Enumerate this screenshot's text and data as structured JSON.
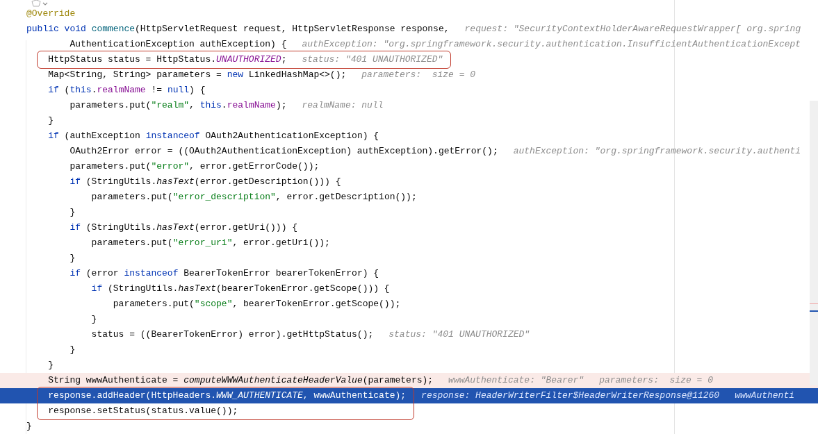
{
  "editor": {
    "lines": [
      {
        "executed": false,
        "current": false,
        "boxed": false,
        "tokens": [
          {
            "kind": "annotation",
            "text": "@Override"
          }
        ]
      },
      {
        "executed": false,
        "current": false,
        "boxed": false,
        "tokens": [
          {
            "kind": "keyword",
            "text": "public"
          },
          {
            "kind": "keyword",
            "text": " void"
          },
          {
            "kind": "method_decl",
            "text": " commence"
          },
          {
            "kind": "plain",
            "text": "(HttpServletRequest request, HttpServletResponse response,"
          }
        ],
        "hints": [
          "request: \"SecurityContextHolderAwareRequestWrapper[ org.spring"
        ]
      },
      {
        "executed": false,
        "current": false,
        "boxed": false,
        "tokens": [
          {
            "kind": "plain",
            "text": "        AuthenticationException authException) {"
          }
        ],
        "hints": [
          "authException: \"org.springframework.security.authentication.InsufficientAuthenticationExcept"
        ]
      },
      {
        "executed": false,
        "current": false,
        "boxed": true,
        "tokens": [
          {
            "kind": "plain",
            "text": "    HttpStatus status = HttpStatus."
          },
          {
            "kind": "constant",
            "text": "UNAUTHORIZED"
          },
          {
            "kind": "plain",
            "text": ";"
          }
        ],
        "hints": [
          "status: \"401 UNAUTHORIZED\""
        ]
      },
      {
        "executed": false,
        "current": false,
        "boxed": false,
        "tokens": [
          {
            "kind": "plain",
            "text": "    Map<String, String> parameters = "
          },
          {
            "kind": "keyword",
            "text": "new"
          },
          {
            "kind": "plain",
            "text": " LinkedHashMap<>();"
          }
        ],
        "hints": [
          "parameters:  size = 0"
        ]
      },
      {
        "executed": false,
        "current": false,
        "boxed": false,
        "tokens": [
          {
            "kind": "keyword",
            "text": "    if"
          },
          {
            "kind": "plain",
            "text": " ("
          },
          {
            "kind": "keyword",
            "text": "this"
          },
          {
            "kind": "plain",
            "text": "."
          },
          {
            "kind": "field",
            "text": "realmName"
          },
          {
            "kind": "plain",
            "text": " != "
          },
          {
            "kind": "keyword",
            "text": "null"
          },
          {
            "kind": "plain",
            "text": ") {"
          }
        ]
      },
      {
        "executed": false,
        "current": false,
        "boxed": false,
        "tokens": [
          {
            "kind": "plain",
            "text": "        parameters.put("
          },
          {
            "kind": "string",
            "text": "\"realm\""
          },
          {
            "kind": "plain",
            "text": ", "
          },
          {
            "kind": "keyword",
            "text": "this"
          },
          {
            "kind": "plain",
            "text": "."
          },
          {
            "kind": "field",
            "text": "realmName"
          },
          {
            "kind": "plain",
            "text": ");"
          }
        ],
        "hints": [
          "realmName: null"
        ]
      },
      {
        "executed": false,
        "current": false,
        "boxed": false,
        "tokens": [
          {
            "kind": "plain",
            "text": "    }"
          }
        ]
      },
      {
        "executed": false,
        "current": false,
        "boxed": false,
        "tokens": [
          {
            "kind": "keyword",
            "text": "    if"
          },
          {
            "kind": "plain",
            "text": " (authException "
          },
          {
            "kind": "keyword",
            "text": "instanceof"
          },
          {
            "kind": "plain",
            "text": " OAuth2AuthenticationException) {"
          }
        ]
      },
      {
        "executed": false,
        "current": false,
        "boxed": false,
        "tokens": [
          {
            "kind": "plain",
            "text": "        OAuth2Error error = ((OAuth2AuthenticationException) authException).getError();"
          }
        ],
        "hints": [
          "authException: \"org.springframework.security.authenti"
        ]
      },
      {
        "executed": false,
        "current": false,
        "boxed": false,
        "tokens": [
          {
            "kind": "plain",
            "text": "        parameters.put("
          },
          {
            "kind": "string",
            "text": "\"error\""
          },
          {
            "kind": "plain",
            "text": ", error.getErrorCode());"
          }
        ]
      },
      {
        "executed": false,
        "current": false,
        "boxed": false,
        "tokens": [
          {
            "kind": "keyword",
            "text": "        if"
          },
          {
            "kind": "plain",
            "text": " (StringUtils."
          },
          {
            "kind": "static_call",
            "text": "hasText"
          },
          {
            "kind": "plain",
            "text": "(error.getDescription())) {"
          }
        ]
      },
      {
        "executed": false,
        "current": false,
        "boxed": false,
        "tokens": [
          {
            "kind": "plain",
            "text": "            parameters.put("
          },
          {
            "kind": "string",
            "text": "\"error_description\""
          },
          {
            "kind": "plain",
            "text": ", error.getDescription());"
          }
        ]
      },
      {
        "executed": false,
        "current": false,
        "boxed": false,
        "tokens": [
          {
            "kind": "plain",
            "text": "        }"
          }
        ]
      },
      {
        "executed": false,
        "current": false,
        "boxed": false,
        "tokens": [
          {
            "kind": "keyword",
            "text": "        if"
          },
          {
            "kind": "plain",
            "text": " (StringUtils."
          },
          {
            "kind": "static_call",
            "text": "hasText"
          },
          {
            "kind": "plain",
            "text": "(error.getUri())) {"
          }
        ]
      },
      {
        "executed": false,
        "current": false,
        "boxed": false,
        "tokens": [
          {
            "kind": "plain",
            "text": "            parameters.put("
          },
          {
            "kind": "string",
            "text": "\"error_uri\""
          },
          {
            "kind": "plain",
            "text": ", error.getUri());"
          }
        ]
      },
      {
        "executed": false,
        "current": false,
        "boxed": false,
        "tokens": [
          {
            "kind": "plain",
            "text": "        }"
          }
        ]
      },
      {
        "executed": false,
        "current": false,
        "boxed": false,
        "tokens": [
          {
            "kind": "keyword",
            "text": "        if"
          },
          {
            "kind": "plain",
            "text": " (error "
          },
          {
            "kind": "keyword",
            "text": "instanceof"
          },
          {
            "kind": "plain",
            "text": " BearerTokenError bearerTokenError) {"
          }
        ]
      },
      {
        "executed": false,
        "current": false,
        "boxed": false,
        "tokens": [
          {
            "kind": "keyword",
            "text": "            if"
          },
          {
            "kind": "plain",
            "text": " (StringUtils."
          },
          {
            "kind": "static_call",
            "text": "hasText"
          },
          {
            "kind": "plain",
            "text": "(bearerTokenError.getScope())) {"
          }
        ]
      },
      {
        "executed": false,
        "current": false,
        "boxed": false,
        "tokens": [
          {
            "kind": "plain",
            "text": "                parameters.put("
          },
          {
            "kind": "string",
            "text": "\"scope\""
          },
          {
            "kind": "plain",
            "text": ", bearerTokenError.getScope());"
          }
        ]
      },
      {
        "executed": false,
        "current": false,
        "boxed": false,
        "tokens": [
          {
            "kind": "plain",
            "text": "            }"
          }
        ]
      },
      {
        "executed": false,
        "current": false,
        "boxed": false,
        "tokens": [
          {
            "kind": "plain",
            "text": "            status = ((BearerTokenError) error).getHttpStatus();"
          }
        ],
        "hints": [
          "status: \"401 UNAUTHORIZED\""
        ]
      },
      {
        "executed": false,
        "current": false,
        "boxed": false,
        "tokens": [
          {
            "kind": "plain",
            "text": "        }"
          }
        ]
      },
      {
        "executed": false,
        "current": false,
        "boxed": false,
        "tokens": [
          {
            "kind": "plain",
            "text": "    }"
          }
        ]
      },
      {
        "executed": true,
        "current": false,
        "boxed": false,
        "tokens": [
          {
            "kind": "plain",
            "text": "    String wwwAuthenticate = "
          },
          {
            "kind": "static_call",
            "text": "computeWWWAuthenticateHeaderValue"
          },
          {
            "kind": "plain",
            "text": "(parameters);"
          }
        ],
        "hints": [
          "wwwAuthenticate: \"Bearer\"",
          "parameters:  size = 0"
        ]
      },
      {
        "executed": false,
        "current": true,
        "boxed": true,
        "tokens": [
          {
            "kind": "plain",
            "text": "    response.addHeader(HttpHeaders."
          },
          {
            "kind": "constant",
            "text": "WWW_AUTHENTICATE"
          },
          {
            "kind": "plain",
            "text": ", wwwAuthenticate);"
          }
        ],
        "hints": [
          "response: HeaderWriterFilter$HeaderWriterResponse@11260",
          "wwwAuthenti"
        ]
      },
      {
        "executed": false,
        "current": false,
        "boxed": true,
        "tokens": [
          {
            "kind": "plain",
            "text": "    response.setStatus(status.value());"
          }
        ]
      },
      {
        "executed": false,
        "current": false,
        "boxed": false,
        "tokens": [
          {
            "kind": "plain",
            "text": "}"
          }
        ]
      }
    ]
  }
}
